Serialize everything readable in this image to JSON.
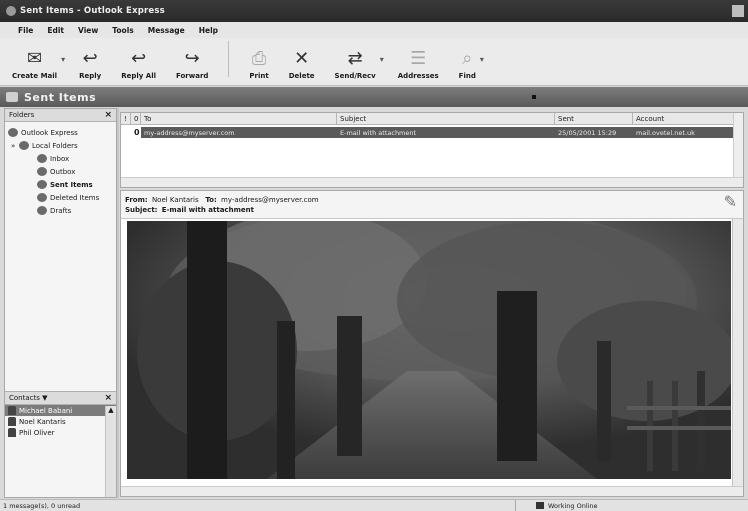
{
  "window": {
    "title": "Sent Items - Outlook Express"
  },
  "menu": [
    "File",
    "Edit",
    "View",
    "Tools",
    "Message",
    "Help"
  ],
  "toolbar": {
    "create_mail": "Create Mail",
    "reply": "Reply",
    "reply_all": "Reply All",
    "forward": "Forward",
    "print": "Print",
    "delete": "Delete",
    "send_recv": "Send/Recv",
    "addresses": "Addresses",
    "find": "Find"
  },
  "folder_bar": {
    "title": "Sent Items"
  },
  "folders_pane": {
    "header": "Folders",
    "items": [
      {
        "label": "Outlook Express",
        "icon": "outlook-express-icon"
      },
      {
        "label": "Local Folders",
        "icon": "local-folders-icon"
      },
      {
        "label": "Inbox",
        "icon": "inbox-icon"
      },
      {
        "label": "Outbox",
        "icon": "outbox-icon"
      },
      {
        "label": "Sent Items",
        "icon": "sent-items-icon"
      },
      {
        "label": "Deleted Items",
        "icon": "deleted-items-icon"
      },
      {
        "label": "Drafts",
        "icon": "drafts-icon"
      }
    ]
  },
  "contacts_pane": {
    "header": "Contacts ▼",
    "items": [
      "Michael Babani",
      "Noel Kantaris",
      "Phil Oliver"
    ]
  },
  "message_list": {
    "columns": {
      "exclaim": "!",
      "attach": "0",
      "to": "To",
      "subject": "Subject",
      "sent": "Sent",
      "account": "Account"
    },
    "rows": [
      {
        "to": "my-address@myserver.com",
        "subject": "E-mail with attachment",
        "sent": "25/05/2001 15:29",
        "account": "mail.ovetel.net.uk"
      }
    ]
  },
  "preview": {
    "from_label": "From:",
    "from": "Noel Kantaris",
    "to_label": "To:",
    "to": "my-address@myserver.com",
    "subject_label": "Subject:",
    "subject": "E-mail with attachment"
  },
  "status": {
    "messages": "1 message(s), 0 unread",
    "connection": "Working Online"
  }
}
